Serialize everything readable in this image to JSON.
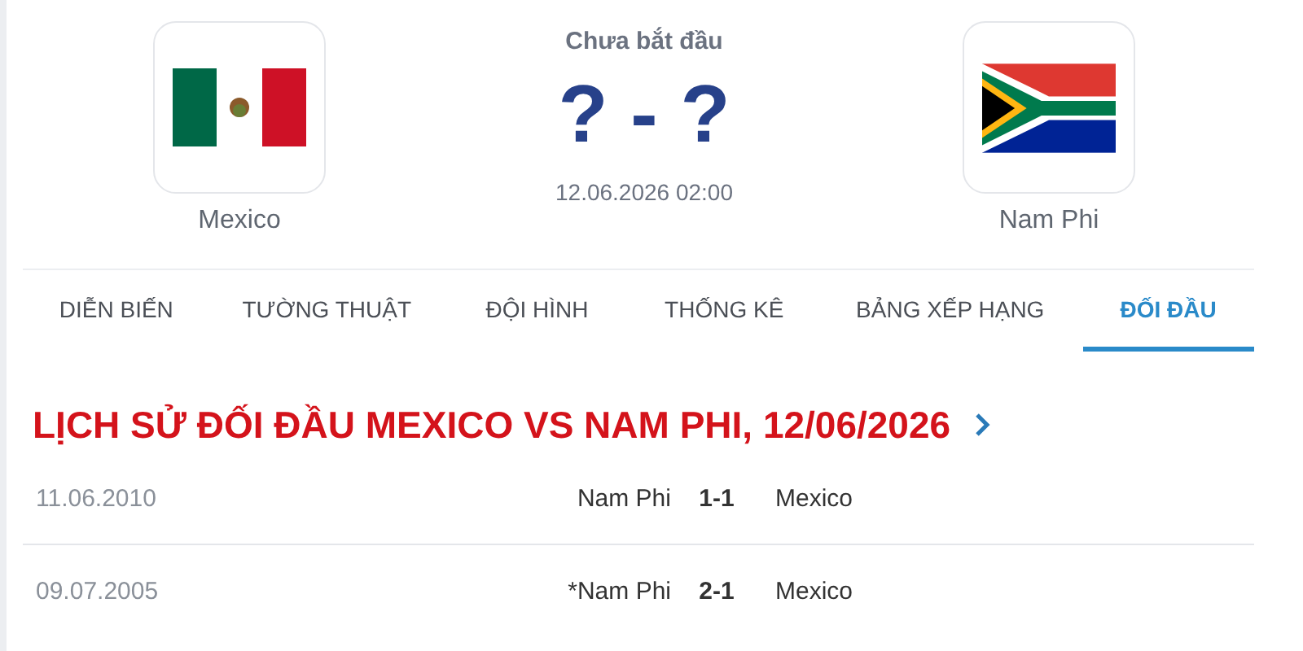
{
  "match": {
    "status": "Chưa bắt đầu",
    "score": "? - ?",
    "datetime": "12.06.2026 02:00",
    "home": {
      "name": "Mexico",
      "kind": "mexico"
    },
    "away": {
      "name": "Nam Phi",
      "kind": "south_africa"
    }
  },
  "tabs": [
    {
      "label": "DIỄN BIẾN",
      "selected": false
    },
    {
      "label": "TƯỜNG THUẬT",
      "selected": false
    },
    {
      "label": "ĐỘI HÌNH",
      "selected": false
    },
    {
      "label": "THỐNG KÊ",
      "selected": false
    },
    {
      "label": "BẢNG XẾP HẠNG",
      "selected": false
    },
    {
      "label": "ĐỐI ĐẦU",
      "selected": true
    }
  ],
  "head_to_head": {
    "title": "LỊCH SỬ ĐỐI ĐẦU MEXICO VS NAM PHI, 12/06/2026",
    "rows": [
      {
        "date": "11.06.2010",
        "home": "Nam Phi",
        "score": "1-1",
        "away": "Mexico"
      },
      {
        "date": "09.07.2005",
        "home": "*Nam Phi",
        "score": "2-1",
        "away": "Mexico"
      }
    ]
  }
}
